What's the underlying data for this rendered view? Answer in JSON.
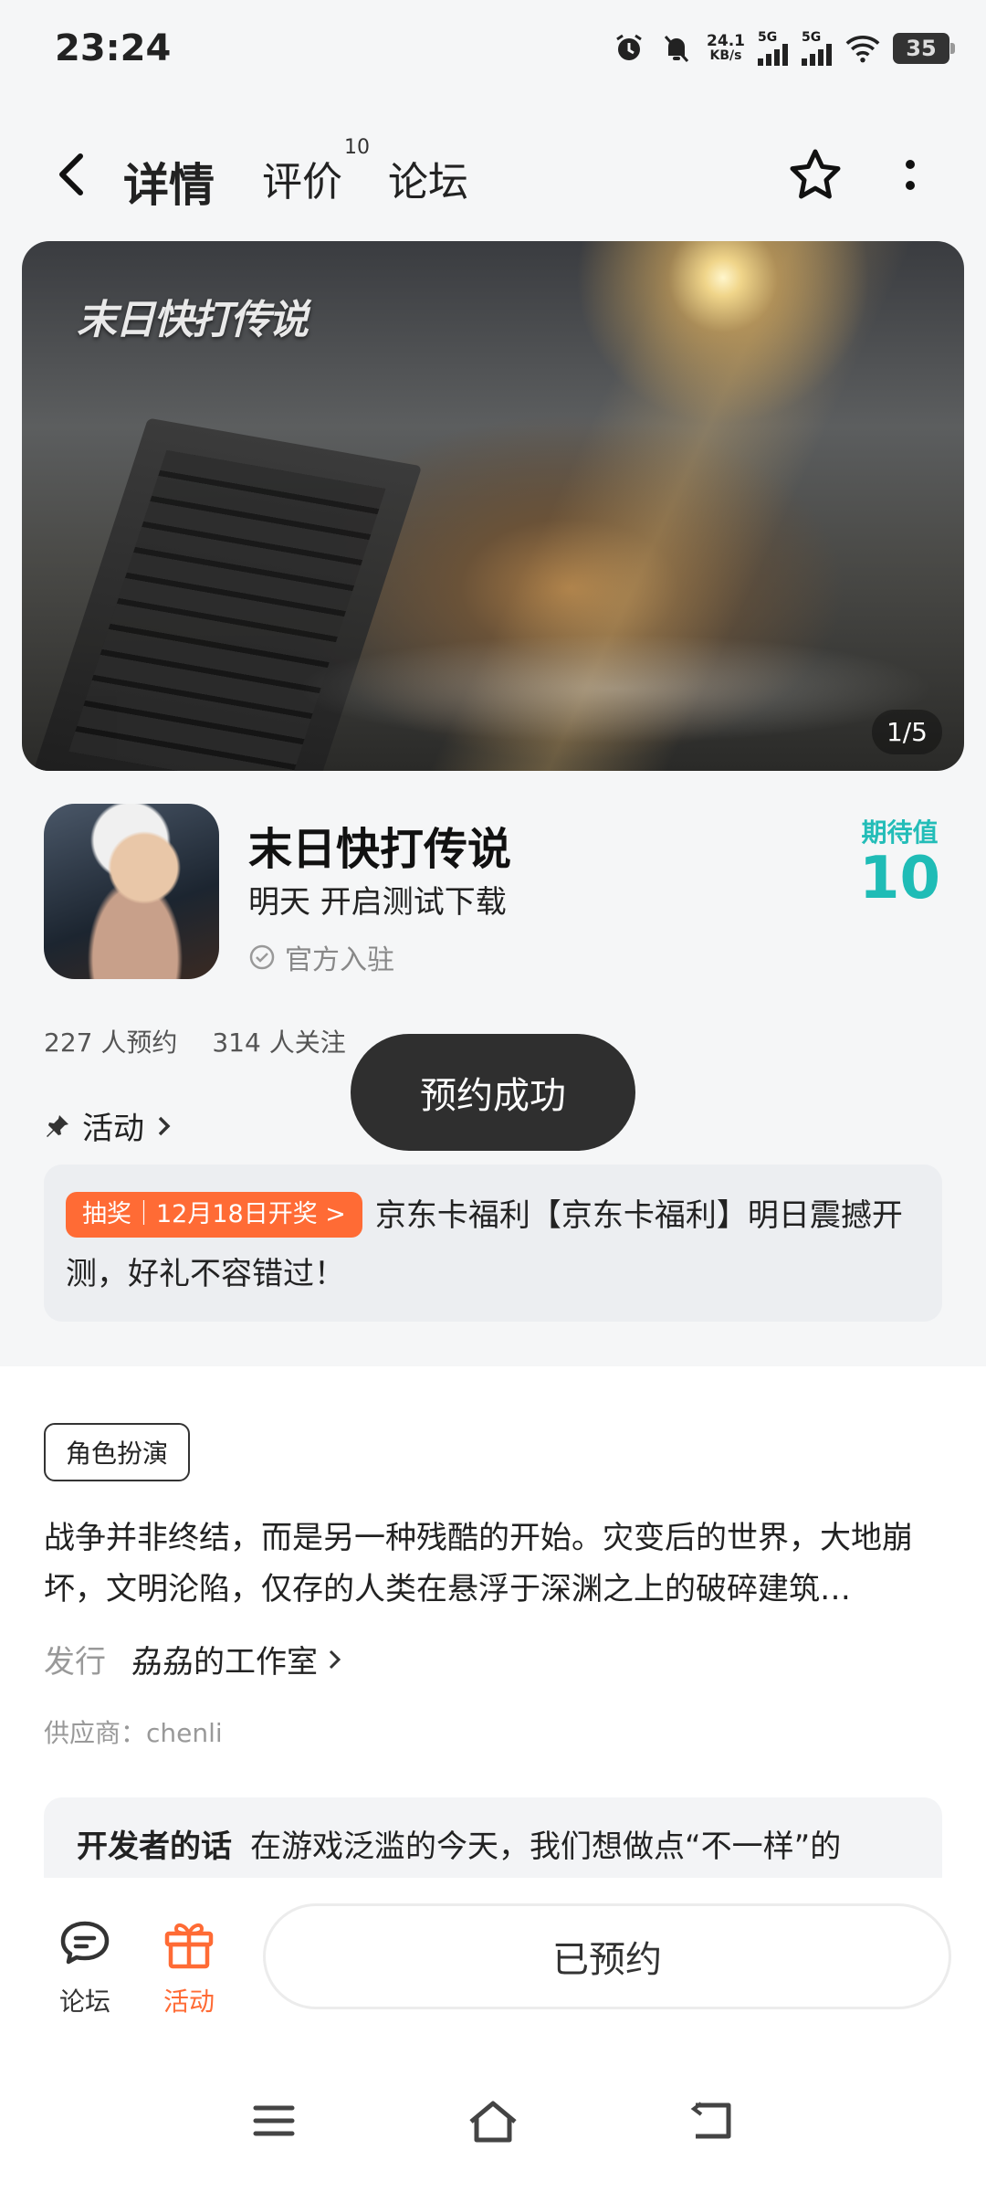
{
  "status_bar": {
    "time": "23:24",
    "net_speed_value": "24.1",
    "net_speed_unit": "KB/s",
    "signal1_label": "5G",
    "signal2_label": "5G",
    "battery": "35"
  },
  "nav": {
    "tabs": [
      {
        "label": "详情",
        "active": true
      },
      {
        "label": "评价",
        "badge": "10"
      },
      {
        "label": "论坛"
      }
    ]
  },
  "banner": {
    "logo_text": "末日快打传说",
    "counter": "1/5"
  },
  "game": {
    "title": "末日快打传说",
    "subtitle": "明天 开启测试下载",
    "official_label": "官方入驻",
    "expect_label": "期待值",
    "expect_value": "10",
    "reservations": "227 人预约",
    "followers": "314 人关注",
    "activity_label": "活动"
  },
  "toast": "预约成功",
  "promo": {
    "tag": "抽奖｜12月18日开奖 >",
    "text": "京东卡福利【京东卡福利】明日震撼开测，好礼不容错过！"
  },
  "detail": {
    "genre": "角色扮演",
    "description": "战争并非终结，而是另一种残酷的开始。灾变后的世界，大地崩坏，文明沦陷，仅存的人类在悬浮于深渊之上的破碎建筑…",
    "publisher_label": "发行",
    "publisher_value": "劦劦的工作室",
    "supplier": "供应商：chenli",
    "dev_words_label": "开发者的话",
    "dev_words_text": "在游戏泛滥的今天，我们想做点“不一样”的"
  },
  "bottom_bar": {
    "forum_label": "论坛",
    "activity_label": "活动",
    "reserved_label": "已预约"
  },
  "colors": {
    "accent_teal": "#1fbcb6",
    "accent_orange": "#ff6b35",
    "toast_bg": "#2f2f2f"
  }
}
